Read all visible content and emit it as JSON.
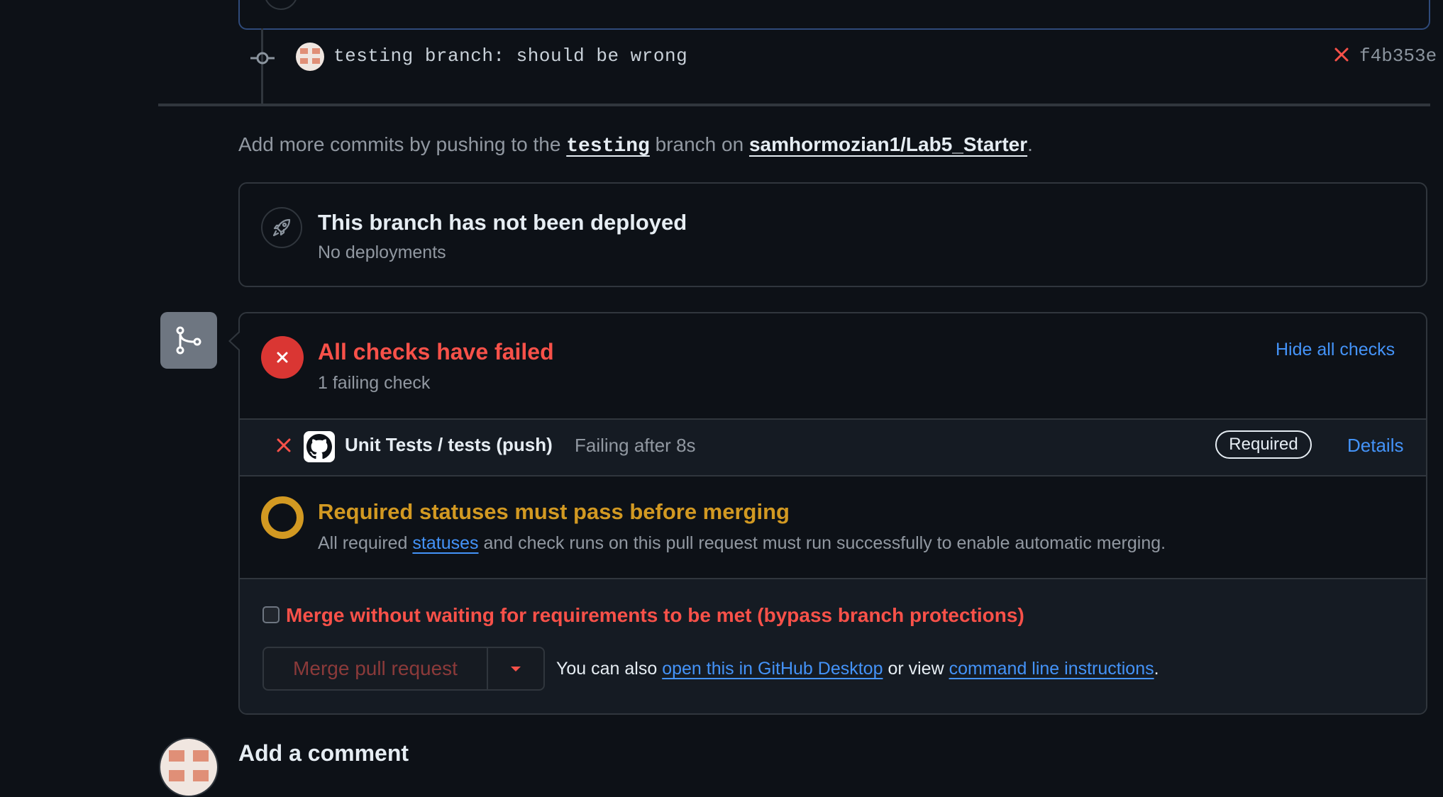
{
  "commit": {
    "message": "testing branch: should be wrong",
    "sha": "f4b353e"
  },
  "add_commits": {
    "prefix": "Add more commits by pushing to the",
    "branch": "testing",
    "middle": "branch on",
    "repo": "samhormozian1/Lab5_Starter",
    "suffix": "."
  },
  "deployment": {
    "title": "This branch has not been deployed",
    "subtitle": "No deployments"
  },
  "checks": {
    "title": "All checks have failed",
    "subtitle": "1 failing check",
    "hide_label": "Hide all checks",
    "items": [
      {
        "name": "Unit Tests / tests (push)",
        "status": "Failing after 8s",
        "badge": "Required",
        "details_label": "Details"
      }
    ]
  },
  "required_status": {
    "title": "Required statuses must pass before merging",
    "sub_prefix": "All required",
    "sub_link": "statuses",
    "sub_suffix": "and check runs on this pull request must run successfully to enable automatic merging."
  },
  "bypass": {
    "label": "Merge without waiting for requirements to be met (bypass branch protections)",
    "checked": false
  },
  "merge": {
    "button_label": "Merge pull request",
    "also_prefix": "You can also",
    "desktop_link": "open this in GitHub Desktop",
    "or_view": "or view",
    "cli_link": "command line instructions",
    "suffix": "."
  },
  "comment": {
    "title": "Add a comment"
  },
  "colors": {
    "background": "#0d1117",
    "danger": "#f85149",
    "warning": "#d29922",
    "link": "#4493f8",
    "border": "#30363d"
  }
}
